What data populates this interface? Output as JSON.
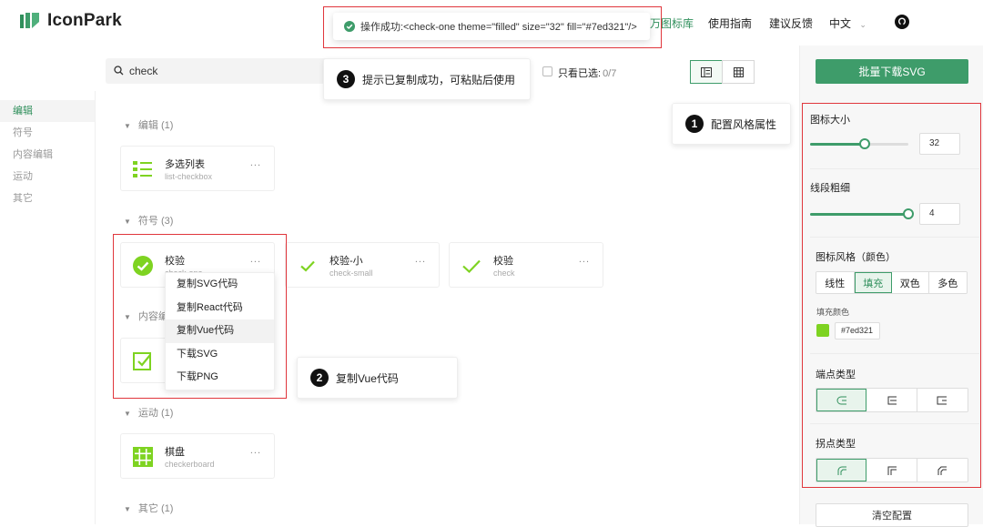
{
  "header": {
    "logo_text": "IconPark",
    "nav": [
      "万图标库",
      "使用指南",
      "建议反馈",
      "中文"
    ]
  },
  "toast": {
    "text": "操作成功:<check-one theme=\"filled\" size=\"32\" fill=\"#7ed321\"/>"
  },
  "search": {
    "value": "check",
    "only_selected_label": "只看已选:",
    "only_selected_count": "0/7"
  },
  "sidebar": {
    "items": [
      {
        "label": "编辑"
      },
      {
        "label": "符号"
      },
      {
        "label": "内容编辑"
      },
      {
        "label": "运动"
      },
      {
        "label": "其它"
      }
    ]
  },
  "groups": {
    "edit": "编辑 (1)",
    "symbol": "符号 (3)",
    "content": "内容编",
    "sport": "运动 (1)",
    "other": "其它 (1)"
  },
  "cards": {
    "list_checkbox": {
      "name": "多选列表",
      "slug": "list-checkbox"
    },
    "check_one": {
      "name": "校验",
      "slug": "check-one"
    },
    "check_small": {
      "name": "校验-小",
      "slug": "check-small"
    },
    "check": {
      "name": "校验",
      "slug": "check"
    },
    "checkerboard": {
      "name": "棋盘",
      "slug": "checkerboard"
    },
    "more": "..."
  },
  "menu": {
    "items": [
      "复制SVG代码",
      "复制React代码",
      "复制Vue代码",
      "下载SVG",
      "下载PNG"
    ]
  },
  "callouts": {
    "c1": {
      "num": "1",
      "text": "配置风格属性"
    },
    "c2": {
      "num": "2",
      "text": "复制Vue代码"
    },
    "c3": {
      "num": "3",
      "text": "提示已复制成功，可粘贴后使用"
    }
  },
  "panel": {
    "download_label": "批量下载SVG",
    "size_label": "图标大小",
    "size_value": "32",
    "stroke_label": "线段粗细",
    "stroke_value": "4",
    "theme_label": "图标风格（颜色）",
    "themes": [
      "线性",
      "填充",
      "双色",
      "多色"
    ],
    "fill_label": "填充颜色",
    "fill_value": "#7ed321",
    "cap_label": "端点类型",
    "join_label": "拐点类型",
    "clear_label": "清空配置"
  },
  "colors": {
    "brand": "#3e9c6a",
    "fill": "#7ed321",
    "highlight_border": "#e0363c"
  }
}
